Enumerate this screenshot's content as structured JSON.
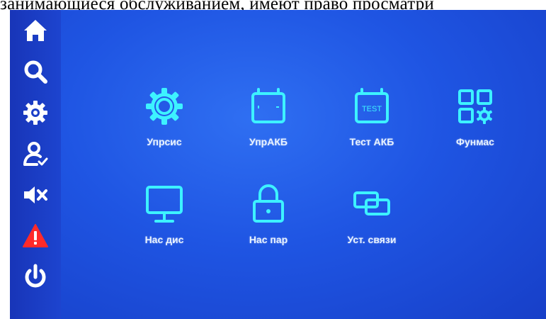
{
  "caption": "занимающиеся обслуживанием, имеют право просматри",
  "sidebar": {
    "items": [
      {
        "icon": "home-icon"
      },
      {
        "icon": "search-icon"
      },
      {
        "icon": "gear-icon"
      },
      {
        "icon": "user-check-icon"
      },
      {
        "icon": "mute-icon"
      },
      {
        "icon": "warning-icon"
      },
      {
        "icon": "power-icon"
      }
    ]
  },
  "menu": {
    "tiles": [
      {
        "label": "Упрсис",
        "icon": "gear-icon"
      },
      {
        "label": "УпрАКБ",
        "icon": "battery-icon"
      },
      {
        "label": "Тест АКБ",
        "icon": "battery-test-icon",
        "icon_text": "TEST"
      },
      {
        "label": "Фунмас",
        "icon": "grid-settings-icon"
      },
      {
        "label": "Нас дис",
        "icon": "monitor-icon"
      },
      {
        "label": "Нас пар",
        "icon": "lock-icon"
      },
      {
        "label": "Уст. связи",
        "icon": "link-windows-icon"
      }
    ]
  },
  "colors": {
    "accent": "#3df2ff",
    "background": "#1f55e3",
    "sidebar": "#1a3cc0",
    "warning": "#ff2a2a"
  }
}
